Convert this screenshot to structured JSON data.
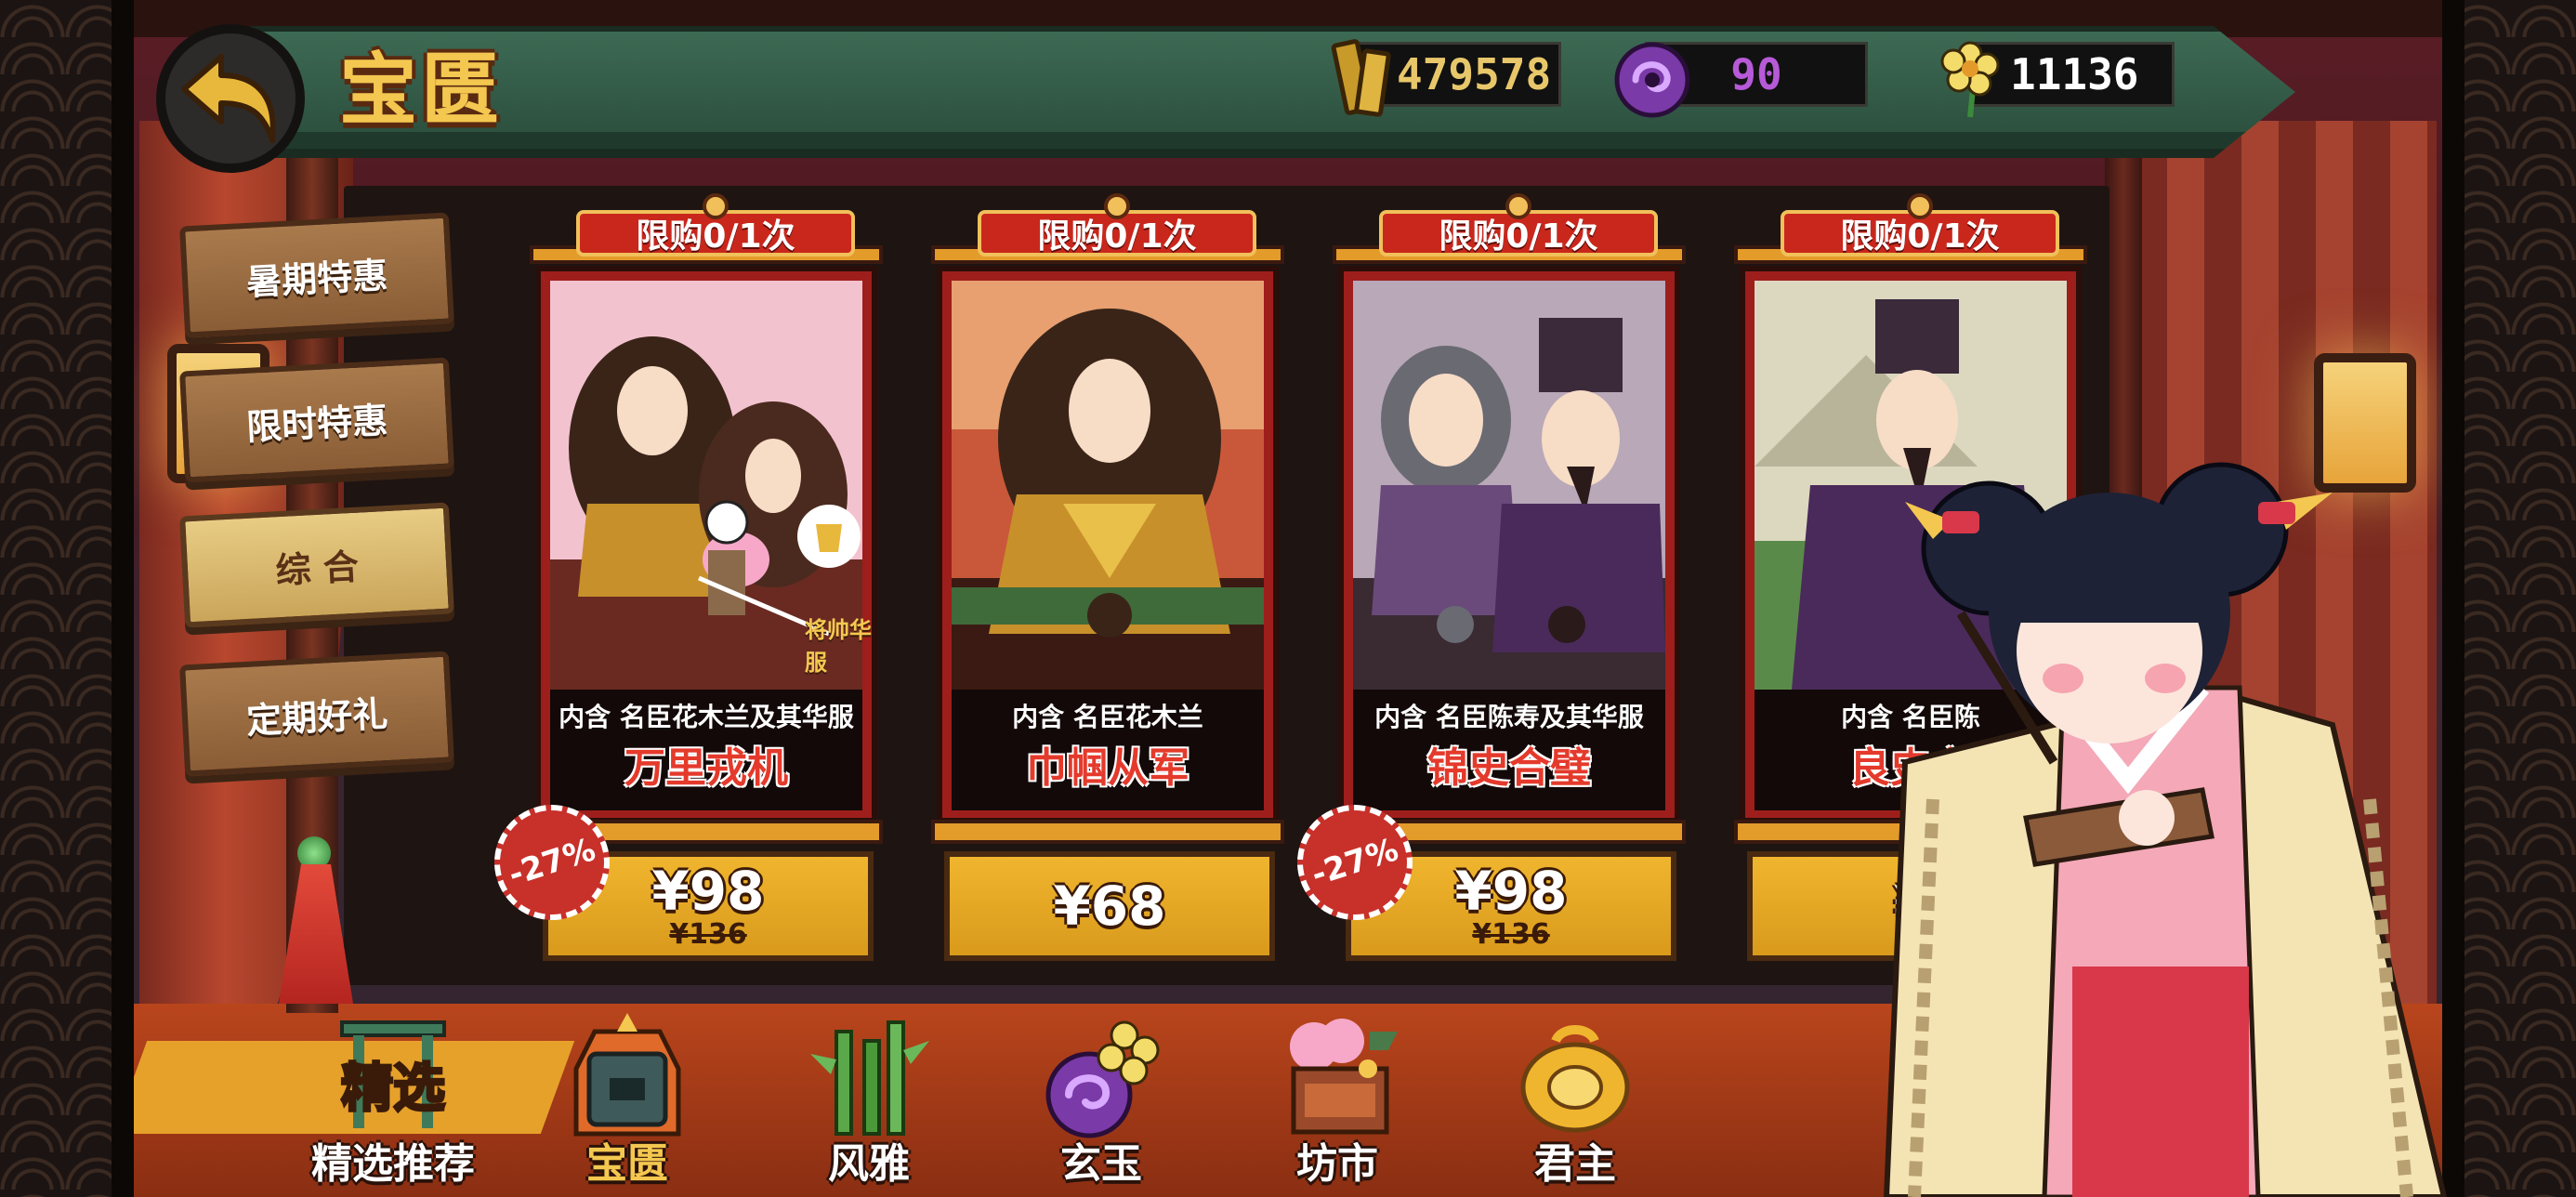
{
  "header": {
    "title": "宝匮",
    "currencies": [
      {
        "id": "gold",
        "icon": "gold-ingot-icon",
        "value": "479578"
      },
      {
        "id": "jade",
        "icon": "purple-jade-icon",
        "value": "90"
      },
      {
        "id": "flower",
        "icon": "flower-icon",
        "value": "11136"
      }
    ]
  },
  "sidebar": {
    "tabs": [
      {
        "label": "暑期特惠",
        "active": false
      },
      {
        "label": "限时特惠",
        "active": false
      },
      {
        "label": "综 合",
        "active": true
      },
      {
        "label": "定期好礼",
        "active": false
      }
    ]
  },
  "cards": [
    {
      "limit": "限购0/1次",
      "note": "内含 名臣花木兰及其华服",
      "name": "万里戎机",
      "price": "¥98",
      "original": "¥136",
      "discount": "-27%",
      "costume_tag": "将帅华服"
    },
    {
      "limit": "限购0/1次",
      "note": "内含 名臣花木兰",
      "name": "巾帼从军",
      "price": "¥68",
      "original": "",
      "discount": ""
    },
    {
      "limit": "限购0/1次",
      "note": "内含 名臣陈寿及其华服",
      "name": "锦史合璧",
      "price": "¥98",
      "original": "¥136",
      "discount": "-27%"
    },
    {
      "limit": "限购0/1次",
      "note": "内含 名臣陈",
      "name": "良史之",
      "price": "¥",
      "original": "",
      "discount": ""
    }
  ],
  "bottom_nav": [
    {
      "icon": "featured-gate-icon",
      "icon_text": "精选",
      "label": "精选推荐",
      "active": false
    },
    {
      "icon": "treasure-chest-icon",
      "label": "宝匮",
      "active": true
    },
    {
      "icon": "bamboo-icon",
      "label": "风雅",
      "active": false
    },
    {
      "icon": "purple-jade-icon",
      "label": "玄玉",
      "active": false
    },
    {
      "icon": "market-stall-icon",
      "label": "坊市",
      "active": false
    },
    {
      "icon": "gold-coin-icon",
      "label": "君主",
      "active": false
    }
  ],
  "colors": {
    "accent": "#f4c850",
    "header_green": "#2a4d3c",
    "price_gold": "#f0b52e",
    "badge_red": "#c9271c",
    "jade_purple": "#b65ad8"
  }
}
